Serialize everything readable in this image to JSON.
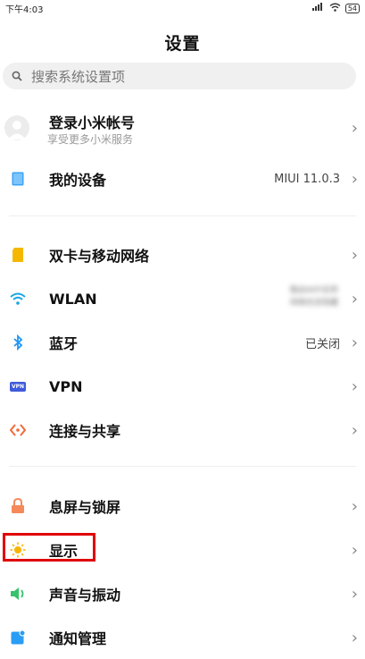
{
  "status_bar": {
    "time": "下午4:03",
    "battery": "54"
  },
  "title": "设置",
  "search": {
    "placeholder": "搜索系统设置项"
  },
  "account": {
    "title": "登录小米帐号",
    "subtitle": "享受更多小米服务"
  },
  "device": {
    "label": "我的设备",
    "value": "MIUI 11.0.3"
  },
  "network": {
    "dual_sim": "双卡与移动网络",
    "wlan": {
      "label": "WLAN",
      "value_line1": "路由WiFi名称",
      "value_line2": "网络信息隐藏"
    },
    "bluetooth": {
      "label": "蓝牙",
      "value": "已关闭"
    },
    "vpn": {
      "label": "VPN",
      "icon_text": "VPN"
    },
    "connection": "连接与共享"
  },
  "system": {
    "lock_screen": "息屏与锁屏",
    "display": "显示",
    "sound": "声音与振动",
    "notifications": "通知管理"
  },
  "colors": {
    "device_icon": "#3aa3f5",
    "sim_icon": "#f5b800",
    "wifi_icon": "#19a6e6",
    "bluetooth_icon": "#2196f3",
    "vpn_icon": "#3f5bd9",
    "share_icon": "#f06a3a",
    "lock_icon": "#f48a5a",
    "display_icon": "#f7b500",
    "sound_icon": "#37c26b",
    "notify_icon": "#2a9df4",
    "highlight": "#e00000"
  }
}
